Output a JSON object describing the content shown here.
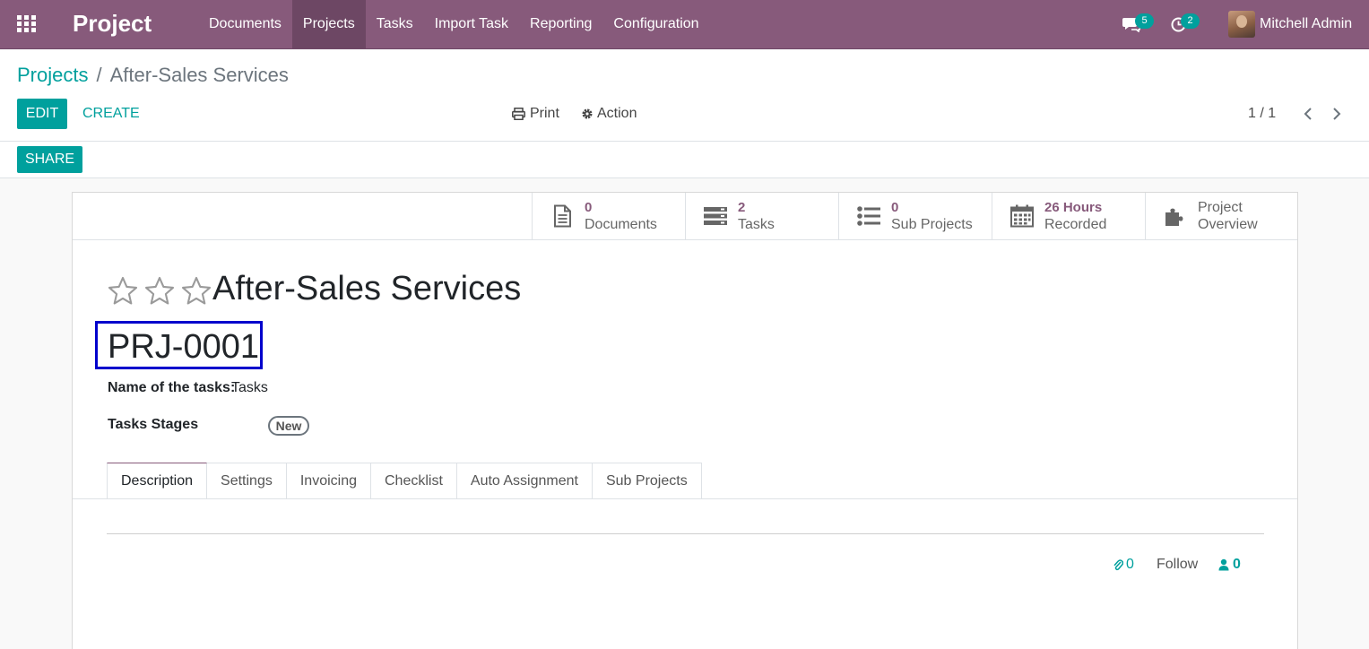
{
  "navbar": {
    "brand": "Project",
    "menu": [
      "Documents",
      "Projects",
      "Tasks",
      "Import Task",
      "Reporting",
      "Configuration"
    ],
    "active_menu": "Projects",
    "messages_count": "5",
    "activities_count": "2",
    "user_name": "Mitchell Admin"
  },
  "control_panel": {
    "breadcrumb_parent": "Projects",
    "breadcrumb_separator": "/",
    "breadcrumb_current": "After-Sales Services",
    "edit_label": "EDIT",
    "create_label": "CREATE",
    "print_label": "Print",
    "action_label": "Action",
    "pager": "1 / 1"
  },
  "statusbar": {
    "share_label": "SHARE"
  },
  "smart_buttons": [
    {
      "value": "0",
      "label": "Documents",
      "icon": "document-icon"
    },
    {
      "value": "2",
      "label": "Tasks",
      "icon": "tasks-icon"
    },
    {
      "value": "0",
      "label": "Sub Projects",
      "icon": "list-icon"
    },
    {
      "value": "26 Hours",
      "label": "Recorded",
      "icon": "calendar-icon"
    },
    {
      "value": "Project",
      "label": "Overview",
      "icon": "puzzle-icon"
    }
  ],
  "form": {
    "title": "After-Sales Services",
    "code": "PRJ-0001",
    "tasks_name_label": "Name of the tasks:",
    "tasks_name_value": "Tasks",
    "stages_label": "Tasks Stages",
    "stage_tag": "New",
    "priority_stars": 0
  },
  "tabs": [
    "Description",
    "Settings",
    "Invoicing",
    "Checklist",
    "Auto Assignment",
    "Sub Projects"
  ],
  "active_tab": "Description",
  "chatter": {
    "attachments_count": "0",
    "follow_label": "Follow",
    "followers_count": "0"
  },
  "colors": {
    "brand": "#875a7b",
    "accent": "#00a09d",
    "highlight_box": "#0000cc"
  }
}
